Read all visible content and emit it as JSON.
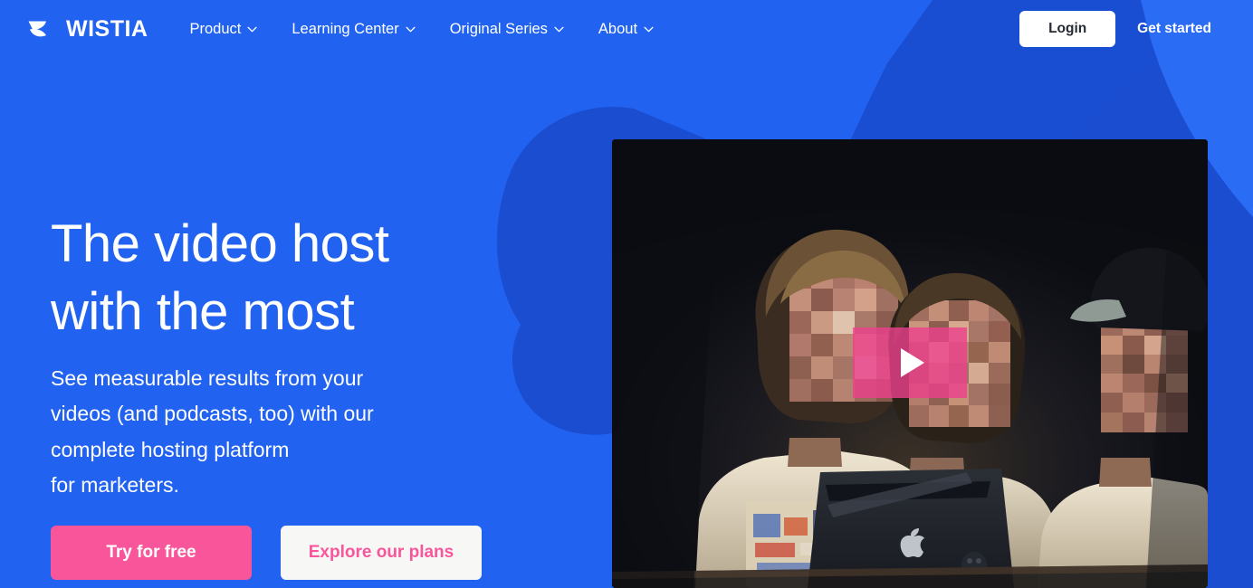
{
  "brand": {
    "name": "WISTIA",
    "logo_icon": "wistia-swoosh-icon"
  },
  "colors": {
    "background_blue": "#2163F0",
    "brush_dark_blue": "#1A4DD0",
    "accent_pink": "#F9559B",
    "play_pink": "#EC408C",
    "button_white": "#FFFFFF",
    "explore_bg": "#F7F7F6",
    "login_text": "#262A33",
    "video_bg": "#0D1117"
  },
  "nav": {
    "items": [
      {
        "label": "Product",
        "has_dropdown": true,
        "icon": "chevron-down-icon"
      },
      {
        "label": "Learning Center",
        "has_dropdown": true,
        "icon": "chevron-down-icon"
      },
      {
        "label": "Original Series",
        "has_dropdown": true,
        "icon": "chevron-down-icon"
      },
      {
        "label": "About",
        "has_dropdown": true,
        "icon": "chevron-down-icon"
      }
    ],
    "login_label": "Login",
    "get_started_label": "Get started"
  },
  "hero": {
    "title_line1": "The video host",
    "title_line2": "with the most",
    "subtitle_line1": "See measurable results from your",
    "subtitle_line2": "videos (and podcasts, too) with our",
    "subtitle_line3": "complete hosting platform",
    "subtitle_line4": "for marketers.",
    "cta_primary": "Try for free",
    "cta_secondary": "Explore our plans"
  },
  "video": {
    "play_icon": "play-triangle-icon",
    "description": "Three people seated in a dark room lit by an open MacBook laptop"
  }
}
